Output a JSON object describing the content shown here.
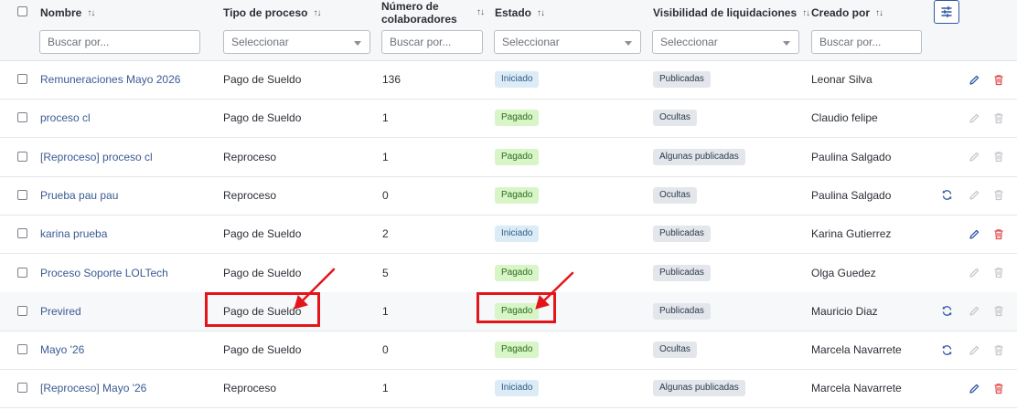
{
  "columns": {
    "nombre": "Nombre",
    "tipo": "Tipo de proceso",
    "colaboradores_line1": "Número de",
    "colaboradores_line2": "colaboradores",
    "estado": "Estado",
    "visibilidad": "Visibilidad de liquidaciones",
    "creado": "Creado por"
  },
  "filters": {
    "nombre_placeholder": "Buscar por...",
    "tipo_placeholder": "Seleccionar",
    "colaboradores_placeholder": "Buscar por...",
    "estado_placeholder": "Seleccionar",
    "visibilidad_placeholder": "Seleccionar",
    "creado_placeholder": "Buscar por..."
  },
  "colors": {
    "accent": "#2f56a6",
    "edit_active": "#2f56a6",
    "delete_active": "#e04b4b",
    "disabled": "#c4c8cd",
    "annotation": "#e3151a"
  },
  "rows": [
    {
      "name": "Remuneraciones Mayo 2026",
      "tipo": "Pago de Sueldo",
      "colaboradores": "136",
      "estado": "Iniciado",
      "estado_kind": "iniciado",
      "visibilidad": "Publicadas",
      "creado": "Leonar Silva",
      "sync": false,
      "edit_active": true,
      "delete_active": true
    },
    {
      "name": "proceso cl",
      "tipo": "Pago de Sueldo",
      "colaboradores": "1",
      "estado": "Pagado",
      "estado_kind": "pagado",
      "visibilidad": "Ocultas",
      "creado": "Claudio felipe",
      "sync": false,
      "edit_active": false,
      "delete_active": false
    },
    {
      "name": "[Reproceso] proceso cl",
      "tipo": "Reproceso",
      "colaboradores": "1",
      "estado": "Pagado",
      "estado_kind": "pagado",
      "visibilidad": "Algunas publicadas",
      "creado": "Paulina Salgado",
      "sync": false,
      "edit_active": false,
      "delete_active": false
    },
    {
      "name": "Prueba pau pau",
      "tipo": "Reproceso",
      "colaboradores": "0",
      "estado": "Pagado",
      "estado_kind": "pagado",
      "visibilidad": "Ocultas",
      "creado": "Paulina Salgado",
      "sync": true,
      "edit_active": false,
      "delete_active": false
    },
    {
      "name": "karina prueba",
      "tipo": "Pago de Sueldo",
      "colaboradores": "2",
      "estado": "Iniciado",
      "estado_kind": "iniciado",
      "visibilidad": "Publicadas",
      "creado": "Karina Gutierrez",
      "sync": false,
      "edit_active": true,
      "delete_active": true
    },
    {
      "name": "Proceso Soporte LOLTech",
      "tipo": "Pago de Sueldo",
      "colaboradores": "5",
      "estado": "Pagado",
      "estado_kind": "pagado",
      "visibilidad": "Publicadas",
      "creado": "Olga Guedez",
      "sync": false,
      "edit_active": false,
      "delete_active": false
    },
    {
      "name": "Previred",
      "tipo": "Pago de Sueldo",
      "colaboradores": "1",
      "estado": "Pagado",
      "estado_kind": "pagado",
      "visibilidad": "Publicadas",
      "creado": "Mauricio Diaz",
      "sync": true,
      "edit_active": false,
      "delete_active": false
    },
    {
      "name": "Mayo '26",
      "tipo": "Pago de Sueldo",
      "colaboradores": "0",
      "estado": "Pagado",
      "estado_kind": "pagado",
      "visibilidad": "Ocultas",
      "creado": "Marcela Navarrete",
      "sync": true,
      "edit_active": false,
      "delete_active": false
    },
    {
      "name": "[Reproceso] Mayo '26",
      "tipo": "Reproceso",
      "colaboradores": "1",
      "estado": "Iniciado",
      "estado_kind": "iniciado",
      "visibilidad": "Algunas publicadas",
      "creado": "Marcela Navarrete",
      "sync": false,
      "edit_active": true,
      "delete_active": true
    }
  ]
}
